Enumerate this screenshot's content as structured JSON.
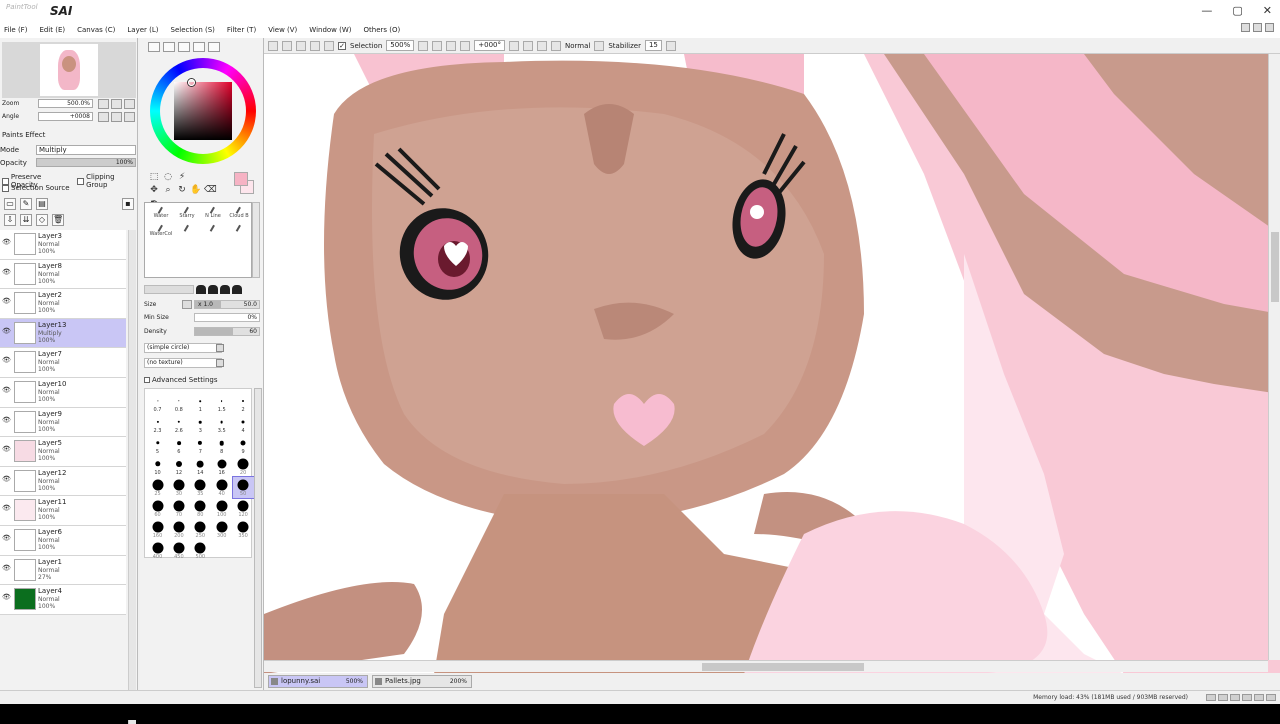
{
  "app": {
    "logo_sub": "PaintTool",
    "logo": "SAI",
    "window_buttons": [
      "—",
      "▢",
      "✕"
    ]
  },
  "menu": [
    {
      "label": "File (F)"
    },
    {
      "label": "Edit (E)"
    },
    {
      "label": "Canvas (C)"
    },
    {
      "label": "Layer (L)"
    },
    {
      "label": "Selection (S)"
    },
    {
      "label": "Filter (T)"
    },
    {
      "label": "View (V)"
    },
    {
      "label": "Window (W)"
    },
    {
      "label": "Others (O)"
    }
  ],
  "toolbar": {
    "selection_label": "Selection",
    "zoom_value": "500%",
    "angle_value": "+000°",
    "blend_mode": "Normal",
    "stabilizer_label": "Stabilizer",
    "stabilizer_value": "15"
  },
  "navigator": {
    "zoom_label": "Zoom",
    "zoom_value": "500.0%",
    "angle_label": "Angle",
    "angle_value": "+0008"
  },
  "layer_props": {
    "paints_effect": "Paints Effect",
    "mode_label": "Mode",
    "mode_value": "Multiply",
    "opacity_label": "Opacity",
    "opacity_value": "100%",
    "preserve_opacity": "Preserve Opacity",
    "clipping_group": "Clipping Group",
    "selection_source": "Selection Source"
  },
  "layers": [
    {
      "name": "Layer3",
      "mode": "Normal",
      "opacity": "100%",
      "selected": false,
      "thumb": "#ffffff"
    },
    {
      "name": "Layer8",
      "mode": "Normal",
      "opacity": "100%",
      "selected": false,
      "thumb": "#ffffff"
    },
    {
      "name": "Layer2",
      "mode": "Normal",
      "opacity": "100%",
      "selected": false,
      "thumb": "#ffffff"
    },
    {
      "name": "Layer13",
      "mode": "Multiply",
      "opacity": "100%",
      "selected": true,
      "thumb": "#ffffff"
    },
    {
      "name": "Layer7",
      "mode": "Normal",
      "opacity": "100%",
      "selected": false,
      "thumb": "#ffffff"
    },
    {
      "name": "Layer10",
      "mode": "Normal",
      "opacity": "100%",
      "selected": false,
      "thumb": "#ffffff"
    },
    {
      "name": "Layer9",
      "mode": "Normal",
      "opacity": "100%",
      "selected": false,
      "thumb": "#ffffff"
    },
    {
      "name": "Layer5",
      "mode": "Normal",
      "opacity": "100%",
      "selected": false,
      "thumb": "#f7dbe4"
    },
    {
      "name": "Layer12",
      "mode": "Normal",
      "opacity": "100%",
      "selected": false,
      "thumb": "#ffffff"
    },
    {
      "name": "Layer11",
      "mode": "Normal",
      "opacity": "100%",
      "selected": false,
      "thumb": "#fbe9ef"
    },
    {
      "name": "Layer6",
      "mode": "Normal",
      "opacity": "100%",
      "selected": false,
      "thumb": "#ffffff"
    },
    {
      "name": "Layer1",
      "mode": "Normal",
      "opacity": "27%",
      "selected": false,
      "thumb": "#ffffff"
    },
    {
      "name": "Layer4",
      "mode": "Normal",
      "opacity": "100%",
      "selected": false,
      "thumb": "#0b6e1e"
    }
  ],
  "brushes": [
    "Water",
    "Starry",
    "N Line",
    "Cloud B",
    "WaterCol",
    "",
    "",
    ""
  ],
  "brush_params": {
    "size_label": "Size",
    "size_mult": "x 1.0",
    "size_value": "50.0",
    "min_size_label": "Min Size",
    "min_size_value": "0%",
    "density_label": "Density",
    "density_value": "60",
    "shape_dd": "(simple circle)",
    "texture_dd": "(no texture)",
    "advanced": "Advanced Settings"
  },
  "brush_sizes": [
    {
      "label": "0.7",
      "r": 0.6
    },
    {
      "label": "0.8",
      "r": 0.7
    },
    {
      "label": "1",
      "r": 0.8
    },
    {
      "label": "1.5",
      "r": 0.9
    },
    {
      "label": "2",
      "r": 1.0
    },
    {
      "label": "2.3",
      "r": 1.1
    },
    {
      "label": "2.6",
      "r": 1.2
    },
    {
      "label": "3",
      "r": 1.3
    },
    {
      "label": "3.5",
      "r": 1.4
    },
    {
      "label": "4",
      "r": 1.5
    },
    {
      "label": "5",
      "r": 1.7
    },
    {
      "label": "6",
      "r": 1.9
    },
    {
      "label": "7",
      "r": 2.1
    },
    {
      "label": "8",
      "r": 2.3
    },
    {
      "label": "9",
      "r": 2.5
    },
    {
      "label": "10",
      "r": 2.7
    },
    {
      "label": "12",
      "r": 3.0
    },
    {
      "label": "14",
      "r": 3.4
    },
    {
      "label": "16",
      "r": 4.5
    },
    {
      "label": "20",
      "r": 5.5
    },
    {
      "label": "25",
      "r": 5.5
    },
    {
      "label": "30",
      "r": 5.5
    },
    {
      "label": "35",
      "r": 5.5
    },
    {
      "label": "40",
      "r": 5.5
    },
    {
      "label": "50",
      "r": 5.5
    },
    {
      "label": "60",
      "r": 5.5
    },
    {
      "label": "70",
      "r": 5.5
    },
    {
      "label": "80",
      "r": 5.5
    },
    {
      "label": "100",
      "r": 5.5
    },
    {
      "label": "120",
      "r": 5.5
    },
    {
      "label": "160",
      "r": 5.5
    },
    {
      "label": "200",
      "r": 5.5
    },
    {
      "label": "250",
      "r": 5.5
    },
    {
      "label": "300",
      "r": 5.5
    },
    {
      "label": "350",
      "r": 5.5
    },
    {
      "label": "400",
      "r": 5.5
    },
    {
      "label": "450",
      "r": 5.5
    },
    {
      "label": "500",
      "r": 5.5
    }
  ],
  "selected_size": "50",
  "tabs": [
    {
      "name": "lopunny.sai",
      "zoom": "500%",
      "active": true
    },
    {
      "name": "Pallets.jpg",
      "zoom": "200%",
      "active": false
    }
  ],
  "status": {
    "memory": "Memory load: 43% (181MB used / 903MB reserved)"
  },
  "colors": {
    "fg": "#f6b3c4",
    "selected_layer": "#c9c6f5"
  }
}
